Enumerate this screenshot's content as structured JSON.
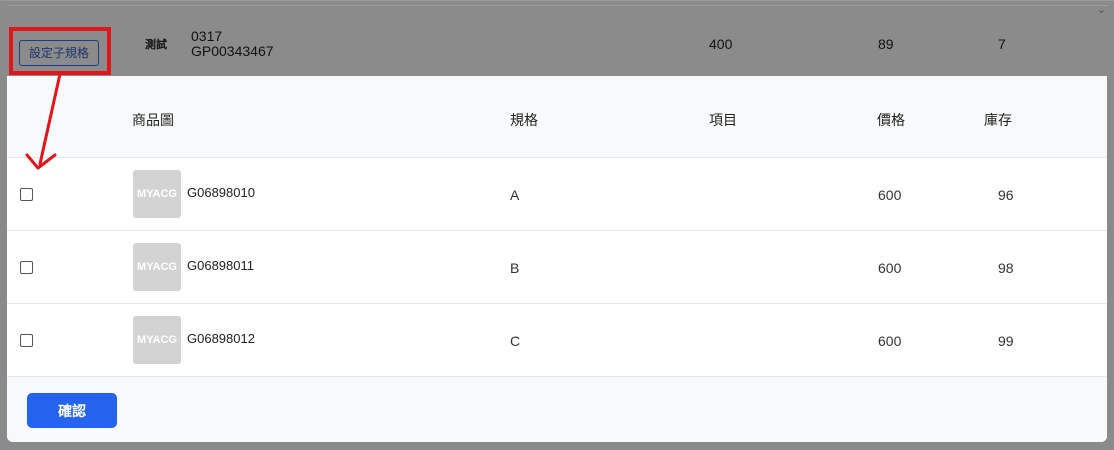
{
  "background_row": {
    "spec_button_label": "設定子規格",
    "tag": "測試",
    "product_line1": "0317",
    "product_line2": "GP00343467",
    "price": "400",
    "value2": "89",
    "value3": "7",
    "collapse_icon": "chevron-down-icon"
  },
  "modal": {
    "headers": {
      "image": "商品圖",
      "spec": "規格",
      "item": "項目",
      "price": "價格",
      "stock": "庫存"
    },
    "rows": [
      {
        "thumb_text": "MYACG",
        "code": "G06898010",
        "spec": "A",
        "item": "",
        "price": "600",
        "stock": "96",
        "checked": false
      },
      {
        "thumb_text": "MYACG",
        "code": "G06898011",
        "spec": "B",
        "item": "",
        "price": "600",
        "stock": "98",
        "checked": false
      },
      {
        "thumb_text": "MYACG",
        "code": "G06898012",
        "spec": "C",
        "item": "",
        "price": "600",
        "stock": "99",
        "checked": false
      }
    ],
    "confirm_label": "確認"
  },
  "annotation": {
    "highlight_color": "#e0161c",
    "arrow_icon": "arrow-down-left-icon"
  },
  "colors": {
    "overlay": "#8a8a8a",
    "primary": "#2463eb",
    "header_bg": "#f8f9fb"
  }
}
